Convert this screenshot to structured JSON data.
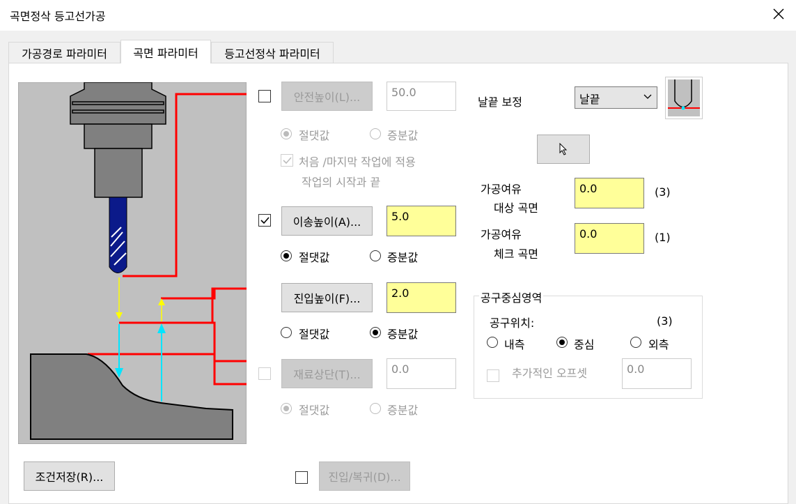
{
  "window": {
    "title": "곡면정삭 등고선가공"
  },
  "tabs": [
    {
      "label": "가공경로 파라미터",
      "active": false
    },
    {
      "label": "곡면 파라미터",
      "active": true
    },
    {
      "label": "등고선정삭 파라미터",
      "active": false
    }
  ],
  "clearance": {
    "button": "안전높이(L)...",
    "value": "50.0",
    "checked": false,
    "enabled": false,
    "absolute": "절댓값",
    "incremental": "증분값",
    "first_last": "처음 /마지막 작업에 적용",
    "start_end": "작업의 시작과 끝"
  },
  "retract": {
    "button": "이송높이(A)...",
    "value": "5.0",
    "checked": true,
    "absolute": "절댓값",
    "incremental": "증분값"
  },
  "feed_plane": {
    "button": "진입높이(F)...",
    "value": "2.0",
    "absolute": "절댓값",
    "incremental": "증분값"
  },
  "top_of_stock": {
    "button": "재료상단(T)...",
    "value": "0.0",
    "checked": false,
    "enabled": false,
    "absolute": "절댓값",
    "incremental": "증분값"
  },
  "tip_comp": {
    "label": "날끝 보정",
    "selected": "날끝"
  },
  "stock_drive": {
    "label1": "가공여유",
    "label2": "대상 곡면",
    "value": "0.0",
    "count": "(3)"
  },
  "stock_check": {
    "label1": "가공여유",
    "label2": "체크 곡면",
    "value": "0.0",
    "count": "(1)"
  },
  "containment": {
    "group": "공구중심영역",
    "tool_pos": "공구위치:",
    "count": "(3)",
    "inside": "내측",
    "center": "중심",
    "outside": "외측",
    "extra_offset": "추가적인 오프셋",
    "offset_value": "0.0"
  },
  "footer": {
    "save": "조건저장(R)...",
    "entry_exit": "진입/복귀(D)..."
  },
  "colors": {
    "highlight_field": "#ffff99",
    "diagram_bg": "#c0c0c0",
    "red_line": "#ff0000",
    "cyan": "#00e5ff",
    "yellow": "#ffff00"
  }
}
